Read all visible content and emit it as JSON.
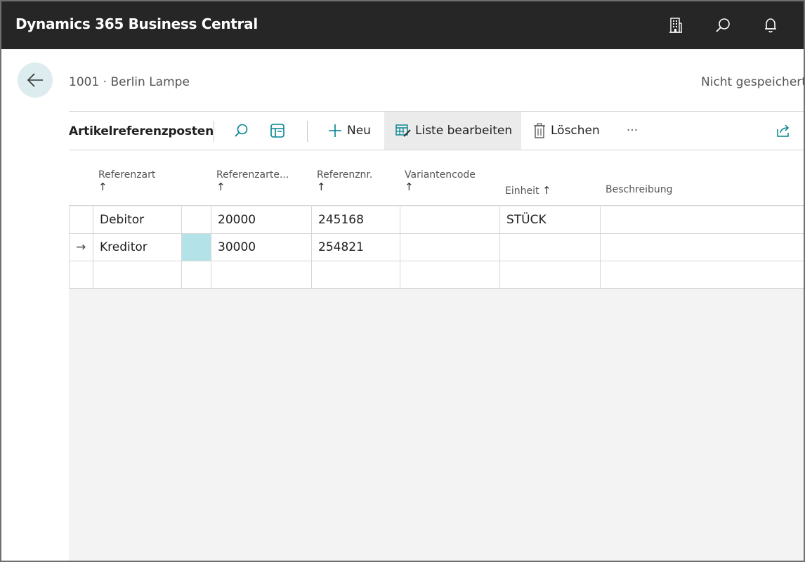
{
  "app": {
    "title": "Dynamics 365 Business Central"
  },
  "appbar_icons": [
    "company-icon",
    "search-icon",
    "bell-icon"
  ],
  "page": {
    "breadcrumb": "1001 · Berlin Lampe",
    "save_status": "Nicht gespeichert"
  },
  "toolbar": {
    "title": "Artikelreferenzposten",
    "new_label": "Neu",
    "edit_list_label": "Liste bearbeiten",
    "delete_label": "Löschen",
    "more_label": "···"
  },
  "columns": {
    "referenzart": "Referenzart",
    "referenzart_nr": "Referenzarte...",
    "referenznr": "Referenznr.",
    "variantencode": "Variantencode",
    "einheit": "Einheit",
    "beschreibung": "Beschreibung",
    "sort_arrow": "↑"
  },
  "rows": [
    {
      "indicator": "",
      "referenzart": "Debitor",
      "referenzart_nr": "20000",
      "referenznr": "245168",
      "variantencode": "",
      "einheit": "STÜCK",
      "beschreibung": ""
    },
    {
      "indicator": "→",
      "referenzart": "Kreditor",
      "referenzart_nr": "30000",
      "referenznr": "254821",
      "variantencode": "",
      "einheit": "",
      "beschreibung": ""
    },
    {
      "indicator": "",
      "referenzart": "",
      "referenzart_nr": "",
      "referenznr": "",
      "variantencode": "",
      "einheit": "",
      "beschreibung": ""
    }
  ],
  "colors": {
    "appbar": "#262626",
    "accent": "#00838f",
    "selected_cell": "#b3e3e8",
    "back_button": "#dcecef"
  }
}
